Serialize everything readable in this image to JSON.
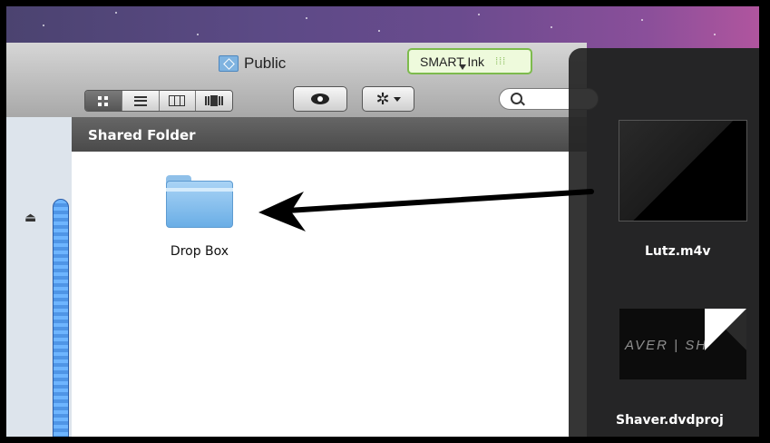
{
  "window": {
    "title": "Public"
  },
  "smart_ink": {
    "label": "SMART Ink",
    "grip": "⁞⁞⁞"
  },
  "toolbar": {
    "view_modes": [
      {
        "name": "icon-view",
        "active": true
      },
      {
        "name": "list-view",
        "active": false
      },
      {
        "name": "column-view",
        "active": false
      },
      {
        "name": "cover-flow-view",
        "active": false
      }
    ],
    "quick_look_icon": "eye-icon",
    "action_icon": "gear-icon",
    "action_glyph": "✲",
    "search": {
      "value": "",
      "placeholder": ""
    }
  },
  "sidebar": {
    "eject_glyph": "⏏"
  },
  "content": {
    "path_title": "Shared Folder",
    "items": [
      {
        "label": "Drop Box",
        "icon": "folder-icon"
      }
    ]
  },
  "overlay": {
    "items": [
      {
        "label": "Lutz.m4v",
        "icon": "video-thumbnail"
      },
      {
        "label": "Shaver.dvdproj",
        "icon": "dvd-project-thumbnail",
        "thumb_text": "AVER | SH"
      }
    ]
  },
  "colors": {
    "accent_blue": "#6eb5ff",
    "smart_green": "#7dbb4d",
    "desktop_purple": "#6a4b8e"
  }
}
